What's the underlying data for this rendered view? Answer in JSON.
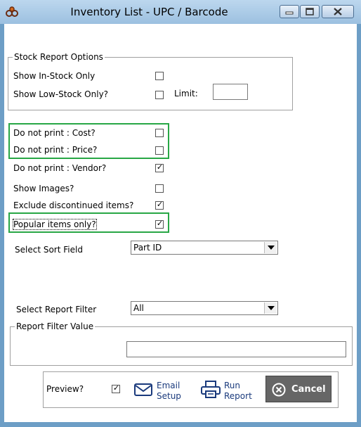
{
  "window": {
    "title": "Inventory List - UPC / Barcode",
    "highlight_color": "#28a745"
  },
  "stock_options": {
    "legend": "Stock Report Options",
    "in_stock_label": "Show In-Stock Only",
    "low_stock_label": "Show Low-Stock Only?",
    "limit_label": "Limit:",
    "in_stock_checked": false,
    "low_stock_checked": false,
    "limit_value": ""
  },
  "options": {
    "cost_label": "Do not print : Cost?",
    "price_label": "Do not print : Price?",
    "vendor_label": "Do not print : Vendor?",
    "images_label": "Show Images?",
    "discontinued_label": "Exclude discontinued items?",
    "popular_label": "Popular items only?",
    "cost_checked": false,
    "price_checked": false,
    "vendor_checked": true,
    "images_checked": false,
    "discontinued_checked": true,
    "popular_checked": true
  },
  "sort": {
    "label": "Select Sort Field",
    "value": "Part ID"
  },
  "filter": {
    "label": "Select Report Filter",
    "value": "All",
    "value_legend": "Report Filter Value",
    "filter_value": ""
  },
  "footer": {
    "preview_label": "Preview?",
    "preview_checked": true,
    "email_line1": "Email",
    "email_line2": "Setup",
    "run_line1": "Run",
    "run_line2": "Report",
    "cancel_label": "Cancel",
    "check_glyph": "✓"
  }
}
